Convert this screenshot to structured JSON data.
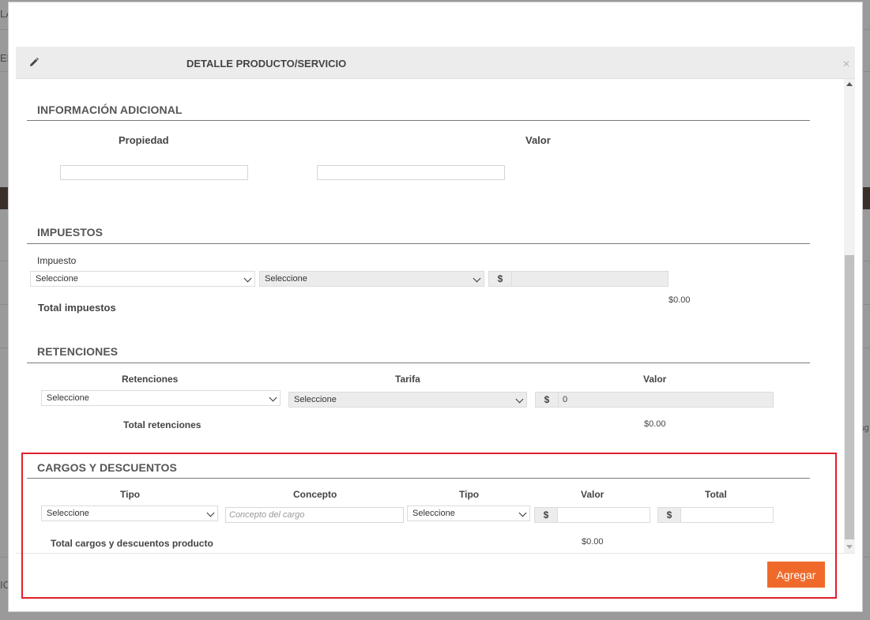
{
  "background": {
    "fragments": [
      "LA",
      "ERV",
      "sag",
      "IC"
    ]
  },
  "modal": {
    "title": "DETALLE PRODUCTO/SERVICIO",
    "close_symbol": "×"
  },
  "info_adicional": {
    "title": "INFORMACIÓN ADICIONAL",
    "col_propiedad": "Propiedad",
    "col_valor": "Valor",
    "propiedad_value": "",
    "valor_value": ""
  },
  "impuestos": {
    "title": "IMPUESTOS",
    "label_impuesto": "Impuesto",
    "select1": "Seleccione",
    "select2": "Seleccione",
    "currency": "$",
    "amount_value": "",
    "total_label": "Total impuestos",
    "total_value": "$0.00"
  },
  "retenciones": {
    "title": "RETENCIONES",
    "col_retenciones": "Retenciones",
    "col_tarifa": "Tarifa",
    "col_valor": "Valor",
    "select_retencion": "Seleccione",
    "select_tarifa": "Seleccione",
    "currency": "$",
    "valor": "0",
    "total_label": "Total retenciones",
    "total_value": "$0.00"
  },
  "cargos": {
    "title": "CARGOS Y DESCUENTOS",
    "col_tipo1": "Tipo",
    "col_concepto": "Concepto",
    "col_tipo2": "Tipo",
    "col_valor": "Valor",
    "col_total": "Total",
    "select_tipo1": "Seleccione",
    "concepto_placeholder": "Concepto del cargo",
    "select_tipo2": "Seleccione",
    "currency": "$",
    "valor_value": "",
    "total_value_input": "",
    "total_label": "Total cargos y descuentos producto",
    "total_value": "$0.00"
  },
  "footer": {
    "add_button": "Agregar"
  },
  "colors": {
    "accent_button": "#ef6a2a",
    "highlight_border": "#e0202a"
  }
}
